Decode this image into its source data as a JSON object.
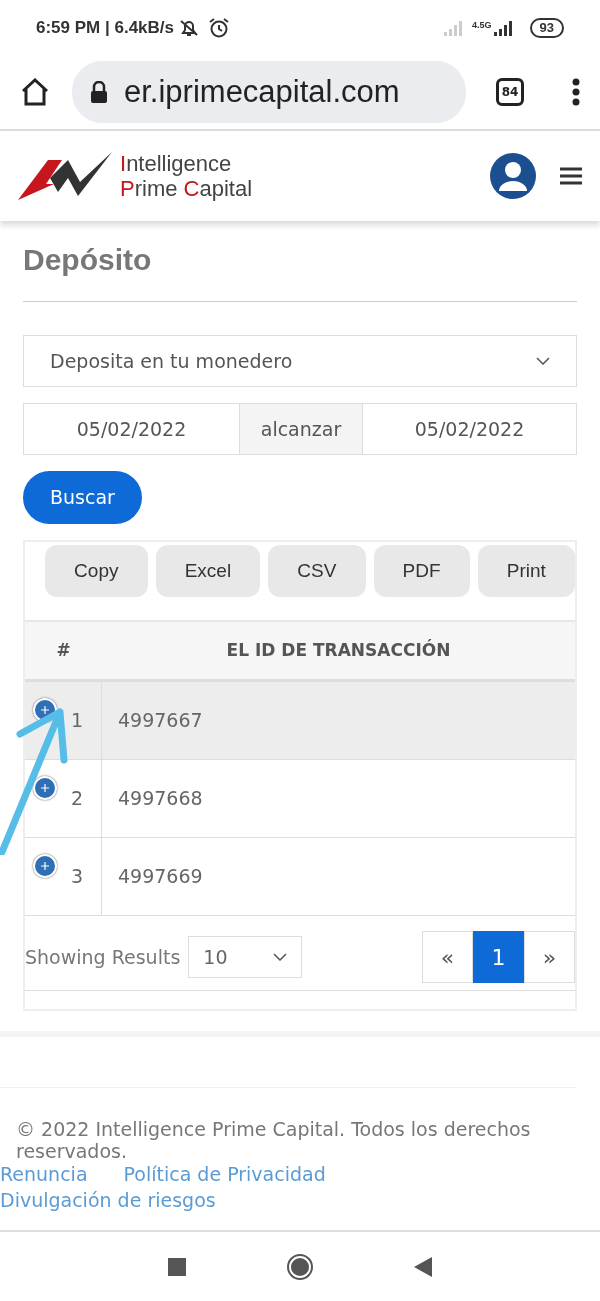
{
  "status_bar": {
    "time": "6:59 PM | 6.4kB/s",
    "network": "4.5G",
    "battery": "93"
  },
  "browser": {
    "url": "er.iprimecapital.com",
    "tab_count": "84"
  },
  "header": {
    "logo": [
      [
        {
          "text": "I",
          "accent": true
        },
        {
          "text": "ntelligence",
          "accent": false
        }
      ],
      [
        {
          "text": "P",
          "accent": true
        },
        {
          "text": "rime ",
          "accent": false
        },
        {
          "text": "C",
          "accent": true
        },
        {
          "text": "apital",
          "accent": false
        }
      ]
    ]
  },
  "page_title": "Depósito",
  "filter": {
    "wallet": "Deposita en tu monedero",
    "date_from": "05/02/2022",
    "range_label": "alcanzar",
    "date_to": "05/02/2022",
    "search_button": "Buscar"
  },
  "export_buttons": [
    "Copy",
    "Excel",
    "CSV",
    "PDF",
    "Print"
  ],
  "table": {
    "columns": [
      "#",
      "EL ID DE TRANSACCIÓN"
    ],
    "rows": [
      {
        "cells": [
          "1",
          "4997667"
        ],
        "highlighted": true
      },
      {
        "cells": [
          "2",
          "4997668"
        ],
        "highlighted": false
      },
      {
        "cells": [
          "3",
          "4997669"
        ],
        "highlighted": false
      }
    ]
  },
  "pagination": {
    "label": "Showing Results",
    "page_size": "10",
    "prev": "«",
    "pages": [
      {
        "label": "1",
        "selected": true
      }
    ],
    "next": "»"
  },
  "footer": {
    "copyright": "© 2022 Intelligence Prime Capital. Todos los derechos reservados.",
    "links": [
      "Renuncia",
      "Política de Privacidad",
      "Divulgación de riesgos"
    ]
  }
}
